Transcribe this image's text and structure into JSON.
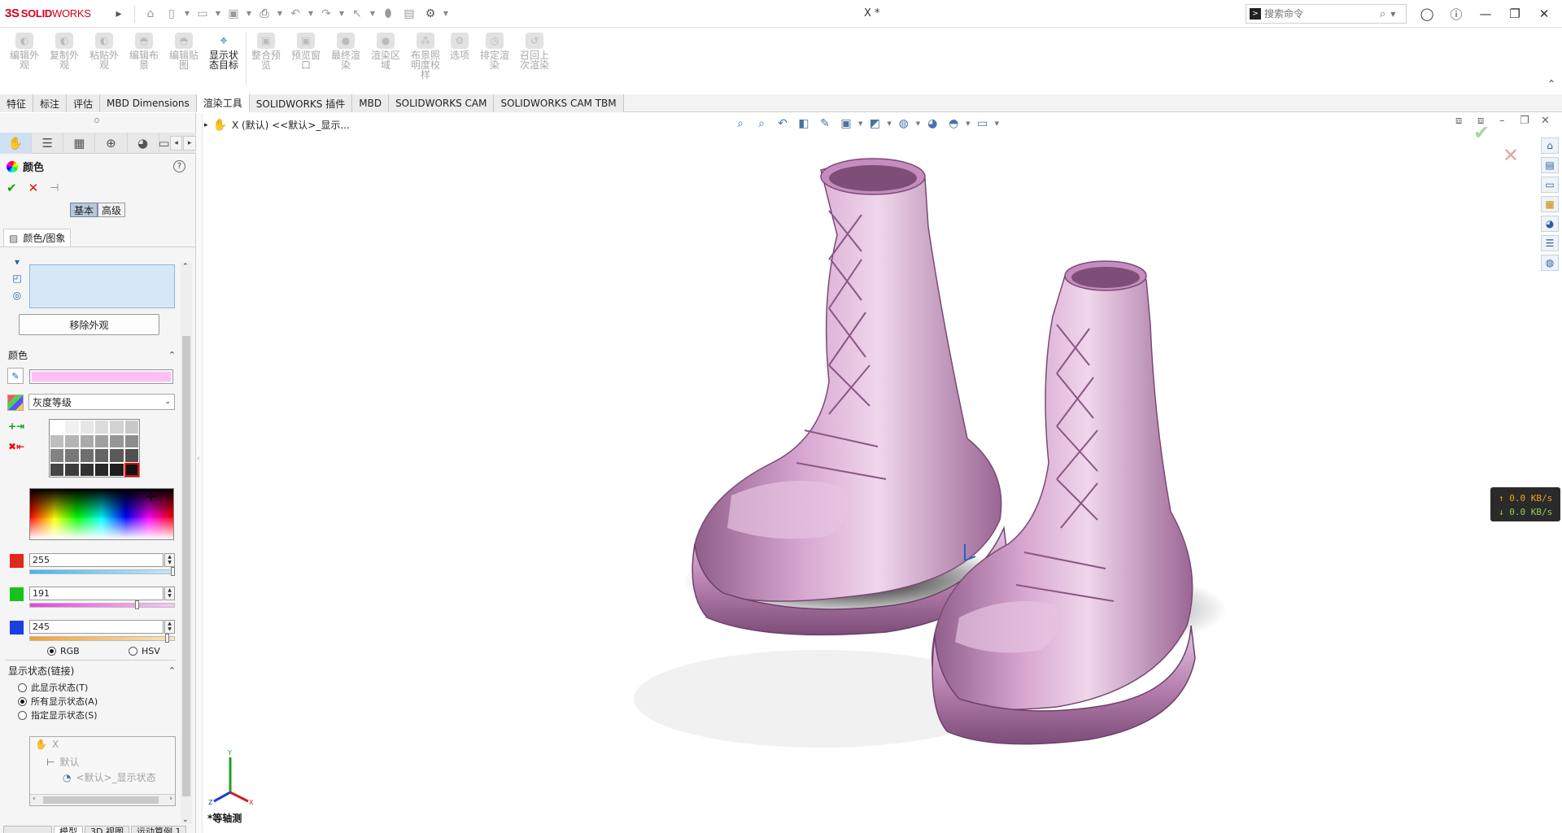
{
  "app": {
    "brand_prefix": "3S",
    "brand_bold": "SOLID",
    "brand_rest": "WORKS",
    "doc_title": "X *"
  },
  "search": {
    "placeholder": "搜索命令"
  },
  "ribbon": {
    "buttons": [
      {
        "label": "编辑外观",
        "enabled": false
      },
      {
        "label": "复制外观",
        "enabled": false
      },
      {
        "label": "粘贴外观",
        "enabled": false
      },
      {
        "label": "编辑布景",
        "enabled": false
      },
      {
        "label": "编辑贴图",
        "enabled": false
      },
      {
        "label": "显示状态目标",
        "enabled": true
      },
      {
        "label": "整合预览",
        "enabled": false
      },
      {
        "label": "预览窗口",
        "enabled": false
      },
      {
        "label": "最终渲染",
        "enabled": false
      },
      {
        "label": "渲染区域",
        "enabled": false
      },
      {
        "label": "布景照明度校样",
        "enabled": false
      },
      {
        "label": "选项",
        "enabled": false
      },
      {
        "label": "排定渲染",
        "enabled": false
      },
      {
        "label": "召回上次渲染",
        "enabled": false
      }
    ]
  },
  "tabs": [
    {
      "label": "特征",
      "active": false
    },
    {
      "label": "标注",
      "active": false
    },
    {
      "label": "评估",
      "active": false
    },
    {
      "label": "MBD Dimensions",
      "active": false
    },
    {
      "label": "渲染工具",
      "active": true
    },
    {
      "label": "SOLIDWORKS 插件",
      "active": false
    },
    {
      "label": "MBD",
      "active": false
    },
    {
      "label": "SOLIDWORKS CAM",
      "active": false
    },
    {
      "label": "SOLIDWORKS CAM TBM",
      "active": false
    }
  ],
  "panel": {
    "title": "颜色",
    "help": "?",
    "mode_basic": "基本",
    "mode_advanced": "高级",
    "subtab": "颜色/图象",
    "remove_button": "移除外观",
    "color_section": "颜色",
    "palette": "灰度等级",
    "selected_color": "#ffbff5",
    "red": "255",
    "green": "191",
    "blue": "245",
    "red_level": 1.0,
    "green_level": 0.749,
    "blue_level": 0.961,
    "rgb_label": "RGB",
    "hsv_label": "HSV",
    "color_model": "RGB",
    "display_state_section": "显示状态(链接)",
    "display_states": [
      {
        "label": "此显示状态(T)",
        "checked": false
      },
      {
        "label": "所有显示状态(A)",
        "checked": true
      },
      {
        "label": "指定显示状态(S)",
        "checked": false
      }
    ],
    "tree": {
      "root": "X",
      "config": "默认",
      "state": "<默认>_显示状态"
    },
    "bottom_tabs": [
      "模型",
      "3D 视图",
      "运动算例 1"
    ]
  },
  "graphics": {
    "feature_tree_crumb": "X (默认) <<默认>_显示...",
    "view_label": "*等轴测",
    "net_up": "↑ 0.0 KB/s",
    "net_down": "↓ 0.0 KB/s",
    "boot_color": "#c98fc0"
  }
}
